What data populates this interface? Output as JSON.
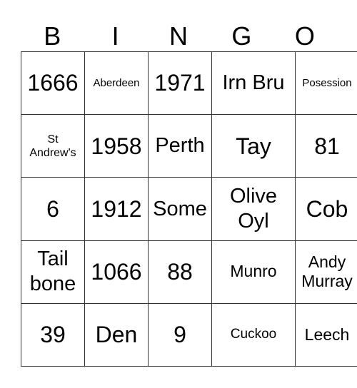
{
  "header": [
    "B",
    "I",
    "N",
    "G",
    "O"
  ],
  "cells": [
    [
      "1666",
      "Aberdeen",
      "1971",
      "Irn Bru",
      "Posession"
    ],
    [
      "St Andrew's",
      "1958",
      "Perth",
      "Tay",
      "81"
    ],
    [
      "6",
      "1912",
      "Some",
      "Olive Oyl",
      "Cob"
    ],
    [
      "Tail bone",
      "1066",
      "88",
      "Munro",
      "Andy Murray"
    ],
    [
      "39",
      "Den",
      "9",
      "Cuckoo",
      "Leech"
    ]
  ]
}
